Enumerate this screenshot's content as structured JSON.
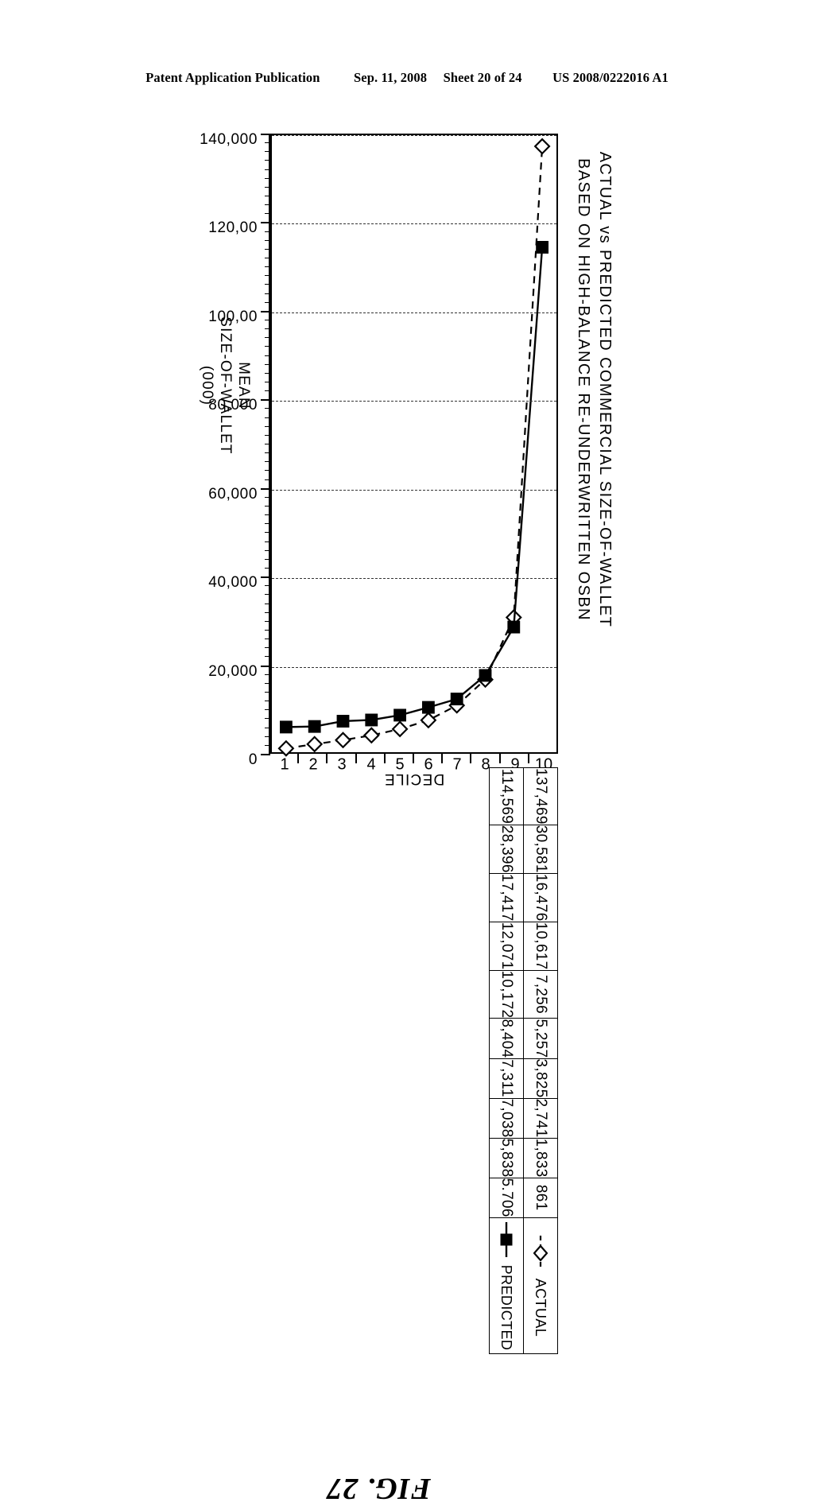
{
  "patent_header": {
    "publication": "Patent Application Publication",
    "date": "Sep. 11, 2008",
    "sheet": "Sheet 20 of 24",
    "number": "US 2008/0222016 A1"
  },
  "figure": {
    "caption": "FIG. 27",
    "title_line1": "ACTUAL vs PREDICTED COMMERCIAL SIZE-OF-WALLET",
    "title_line2": "BASED ON HIGH-BALANCE RE-UNDERWRITTEN OSBN",
    "value_axis_title_line1": "MEAN",
    "value_axis_title_line2": "SIZE-OF-WALLET",
    "value_axis_title_line3": "(000)",
    "category_axis_title": "DECILE"
  },
  "chart_data": {
    "type": "line",
    "title": "ACTUAL vs PREDICTED COMMERCIAL SIZE-OF-WALLET BASED ON HIGH-BALANCE RE-UNDERWRITTEN OSBN",
    "xlabel": "DECILE",
    "ylabel": "MEAN SIZE-OF-WALLET (000)",
    "orientation": "rotated-90",
    "grid": true,
    "grid_axis": "y",
    "legend_position": "table-row-headers",
    "categories": [
      "1",
      "2",
      "3",
      "4",
      "5",
      "6",
      "7",
      "8",
      "9",
      "10"
    ],
    "ylim": [
      0,
      140000
    ],
    "ytick_labels": [
      "0",
      "20,000",
      "40,000",
      "60,000",
      "80,000",
      "100,00",
      "120,00",
      "140,000"
    ],
    "ytick_values": [
      0,
      20000,
      40000,
      60000,
      80000,
      100000,
      120000,
      140000
    ],
    "minor_ticks_per_interval": 10,
    "series": [
      {
        "name": "ACTUAL",
        "marker": "open-diamond",
        "line_style": "dashed",
        "values": [
          861,
          1833,
          2741,
          3825,
          5257,
          7256,
          10617,
          16476,
          30581,
          137469
        ],
        "labels": [
          "861",
          "1,833",
          "2,741",
          "3,825",
          "5,257",
          "7,256",
          "10,617",
          "16,476",
          "30,581",
          "137,469"
        ]
      },
      {
        "name": "PREDICTED",
        "marker": "filled-square",
        "line_style": "solid",
        "values": [
          5706,
          5838,
          7038,
          7311,
          8404,
          10172,
          12071,
          17417,
          28396,
          114569
        ],
        "labels": [
          "5.706",
          "5,838",
          "7,038",
          "7,311",
          "8,404",
          "10,172",
          "12,071",
          "17,417",
          "28,396",
          "114,569"
        ]
      }
    ]
  }
}
